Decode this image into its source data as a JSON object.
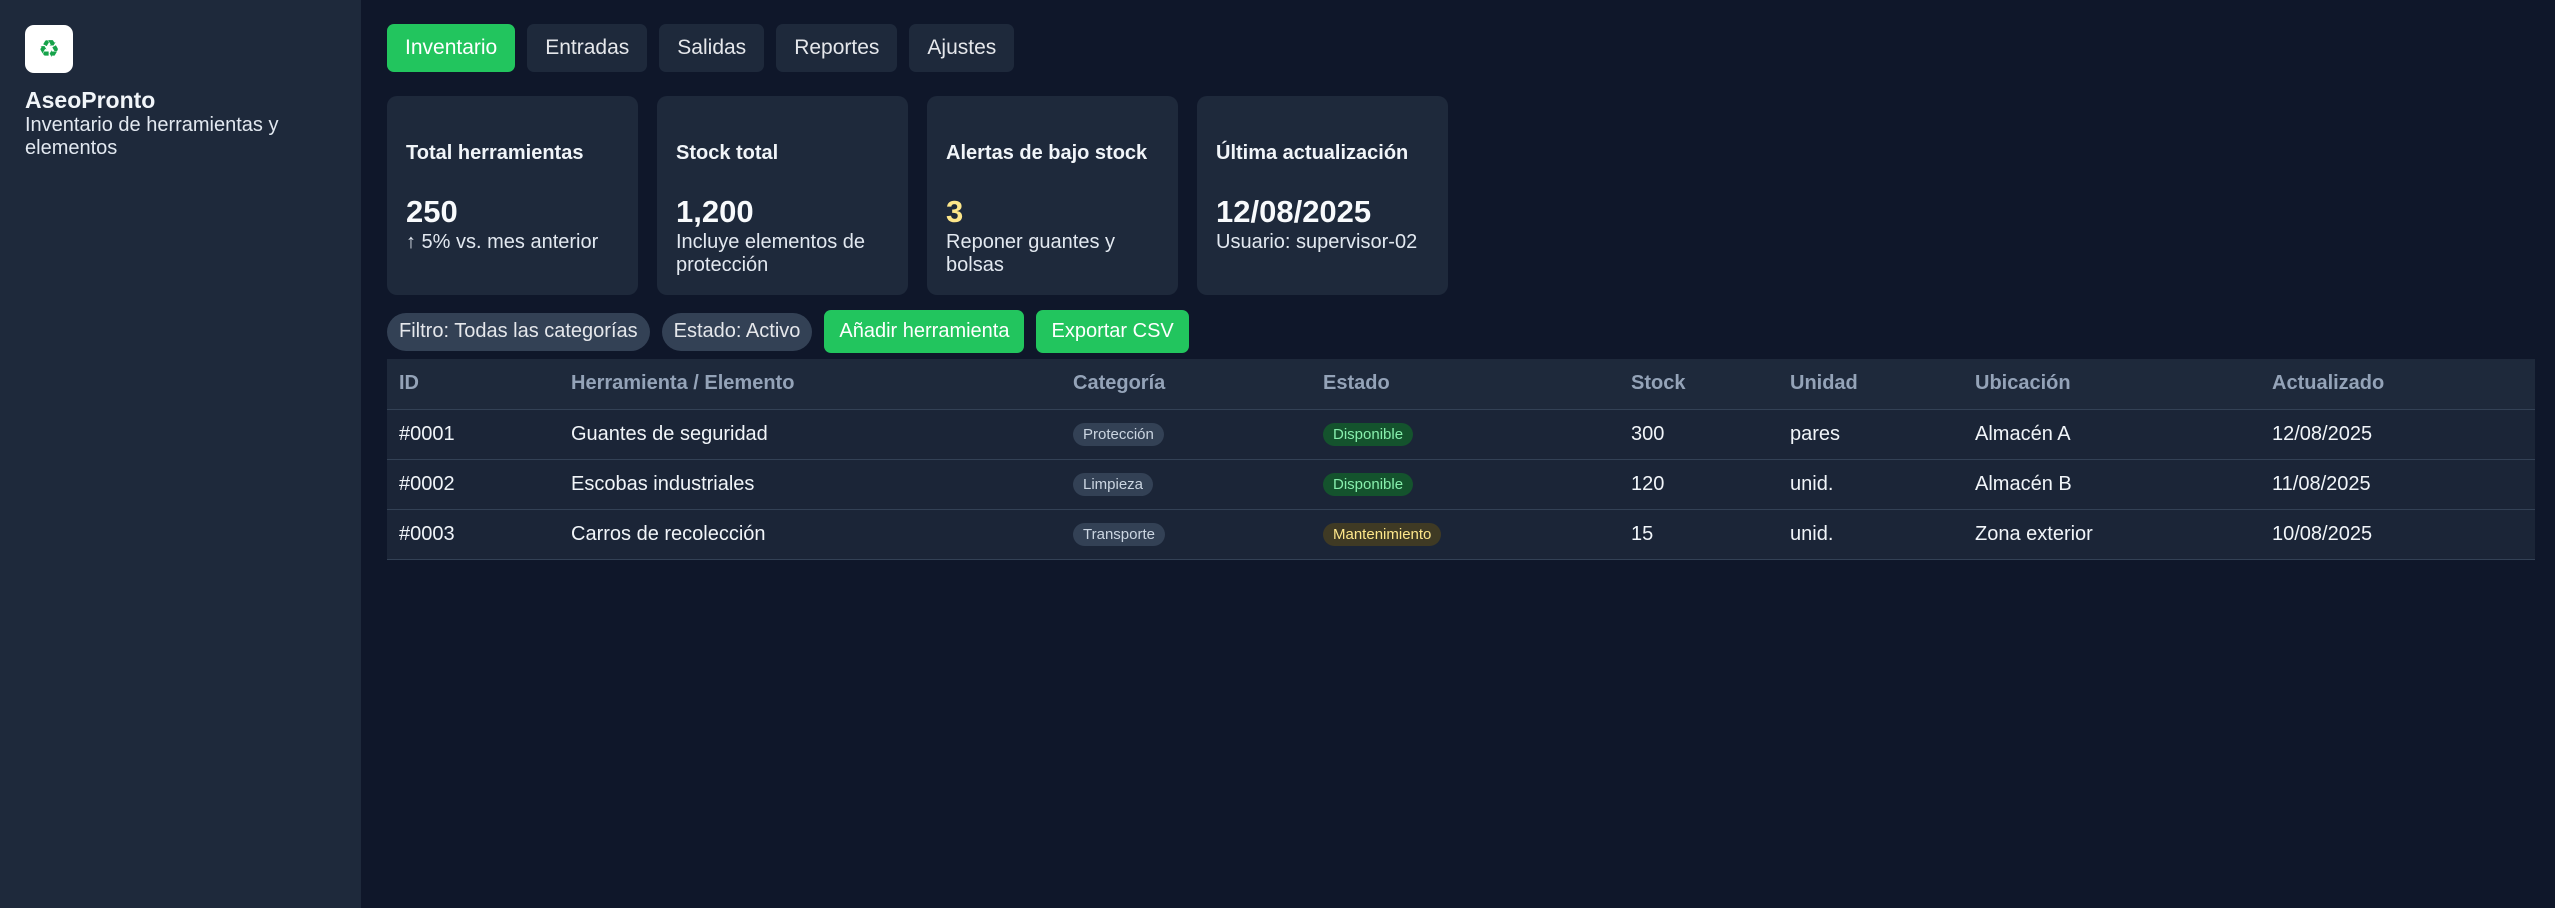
{
  "brand": {
    "logo_icon": "recycle-icon",
    "logo_glyph": "♻",
    "name": "AseoPronto",
    "subtitle": "Inventario de herramientas y elementos"
  },
  "tabs": [
    {
      "label": "Inventario",
      "active": true
    },
    {
      "label": "Entradas",
      "active": false
    },
    {
      "label": "Salidas",
      "active": false
    },
    {
      "label": "Reportes",
      "active": false
    },
    {
      "label": "Ajustes",
      "active": false
    }
  ],
  "cards": [
    {
      "title": "Total herramientas",
      "value": "250",
      "sub": "↑ 5% vs. mes anterior"
    },
    {
      "title": "Stock total",
      "value": "1,200",
      "sub": "Incluye elementos de protección"
    },
    {
      "title": "Alertas de bajo stock",
      "value": "3",
      "sub": "Reponer guantes y bolsas"
    },
    {
      "title": "Última actualización",
      "value": "12/08/2025",
      "sub": "Usuario: supervisor-02"
    }
  ],
  "toolbar": {
    "filter_category": "Filtro: Todas las categorías",
    "filter_status": "Estado: Activo",
    "add_label": "Añadir herramienta",
    "export_label": "Exportar CSV"
  },
  "table": {
    "headers": [
      "ID",
      "Herramienta / Elemento",
      "Categoría",
      "Estado",
      "Stock",
      "Unidad",
      "Ubicación",
      "Actualizado"
    ],
    "rows": [
      {
        "id": "#0001",
        "name": "Guantes de seguridad",
        "category": "Protección",
        "status": "Disponible",
        "stock": "300",
        "unit": "pares",
        "location": "Almacén A",
        "updated": "12/08/2025"
      },
      {
        "id": "#0002",
        "name": "Escobas industriales",
        "category": "Limpieza",
        "status": "Disponible",
        "stock": "120",
        "unit": "unid.",
        "location": "Almacén B",
        "updated": "11/08/2025"
      },
      {
        "id": "#0003",
        "name": "Carros de recolección",
        "category": "Transporte",
        "status": "Mantenimiento",
        "stock": "15",
        "unit": "unid.",
        "location": "Zona exterior",
        "updated": "10/08/2025"
      }
    ]
  },
  "colors": {
    "accent": "#22c55e",
    "background": "#0f172a",
    "surface": "#1e293b",
    "warning": "#fde68a"
  }
}
